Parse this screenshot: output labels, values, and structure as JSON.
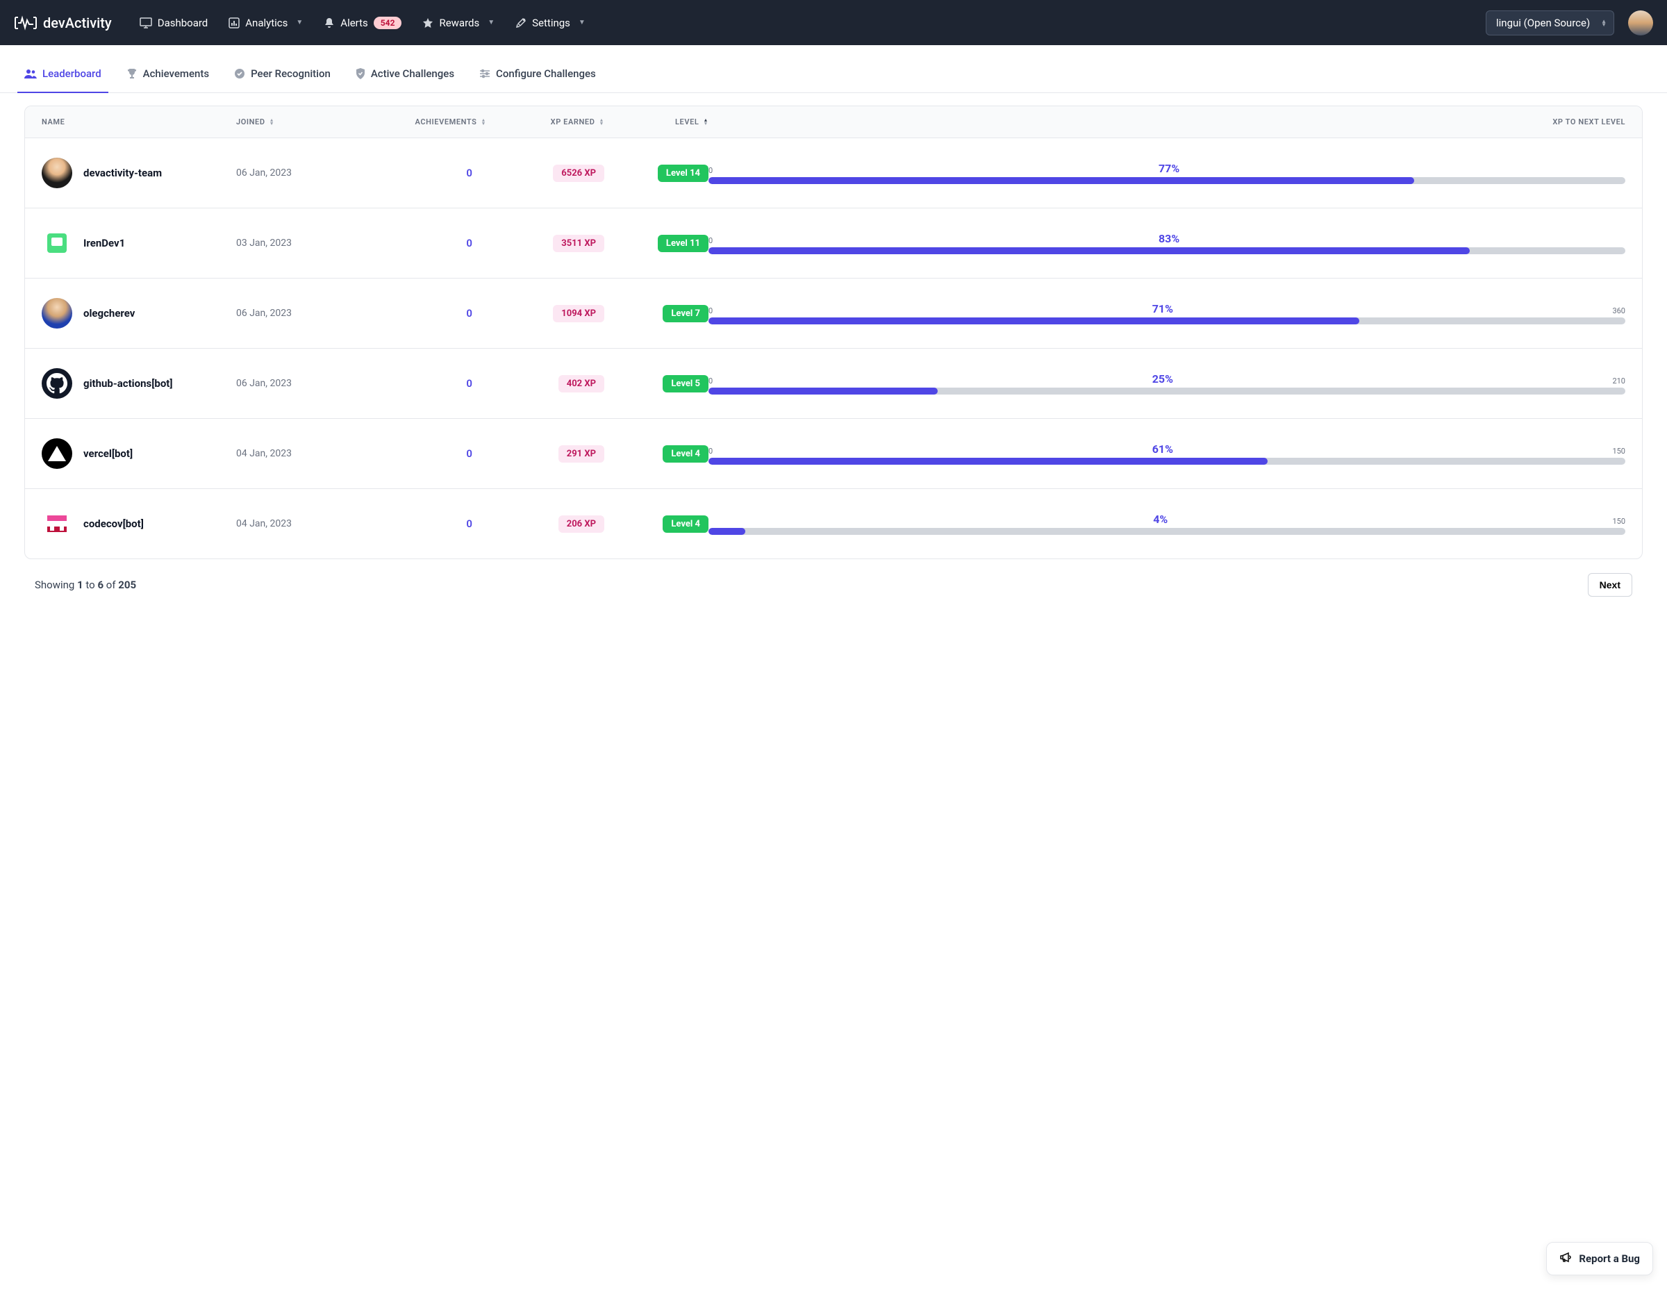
{
  "brand": "devActivity",
  "nav": {
    "dashboard": "Dashboard",
    "analytics": "Analytics",
    "alerts": "Alerts",
    "alerts_count": "542",
    "rewards": "Rewards",
    "settings": "Settings"
  },
  "project_selector": "lingui (Open Source)",
  "tabs": {
    "leaderboard": "Leaderboard",
    "achievements": "Achievements",
    "peer": "Peer Recognition",
    "active": "Active Challenges",
    "configure": "Configure Challenges"
  },
  "table": {
    "headers": {
      "name": "NAME",
      "joined": "JOINED",
      "achievements": "ACHIEVEMENTS",
      "xp": "XP EARNED",
      "level": "LEVEL",
      "xpnext": "XP TO NEXT LEVEL"
    },
    "rows": [
      {
        "name": "devactivity-team",
        "joined": "06 Jan, 2023",
        "ach": "0",
        "xp": "6526 XP",
        "level": "Level 14",
        "pstart": "0",
        "pend": "",
        "pct": "77%",
        "fill": 77,
        "avatar": "person1"
      },
      {
        "name": "IrenDev1",
        "joined": "03 Jan, 2023",
        "ach": "0",
        "xp": "3511 XP",
        "level": "Level 11",
        "pstart": "0",
        "pend": "",
        "pct": "83%",
        "fill": 83,
        "avatar": "green"
      },
      {
        "name": "olegcherev",
        "joined": "06 Jan, 2023",
        "ach": "0",
        "xp": "1094 XP",
        "level": "Level 7",
        "pstart": "0",
        "pend": "360",
        "pct": "71%",
        "fill": 71,
        "avatar": "person2"
      },
      {
        "name": "github-actions[bot]",
        "joined": "06 Jan, 2023",
        "ach": "0",
        "xp": "402 XP",
        "level": "Level 5",
        "pstart": "0",
        "pend": "210",
        "pct": "25%",
        "fill": 25,
        "avatar": "github"
      },
      {
        "name": "vercel[bot]",
        "joined": "04 Jan, 2023",
        "ach": "0",
        "xp": "291 XP",
        "level": "Level 4",
        "pstart": "0",
        "pend": "150",
        "pct": "61%",
        "fill": 61,
        "avatar": "vercel"
      },
      {
        "name": "codecov[bot]",
        "joined": "04 Jan, 2023",
        "ach": "0",
        "xp": "206 XP",
        "level": "Level 4",
        "pstart": "",
        "pend": "150",
        "pct": "4%",
        "fill": 4,
        "avatar": "codecov"
      }
    ]
  },
  "pagination": {
    "prefix": "Showing ",
    "from": "1",
    "to_word": " to ",
    "to": "6",
    "of_word": " of ",
    "total": "205",
    "next": "Next"
  },
  "report_bug": "Report a Bug"
}
